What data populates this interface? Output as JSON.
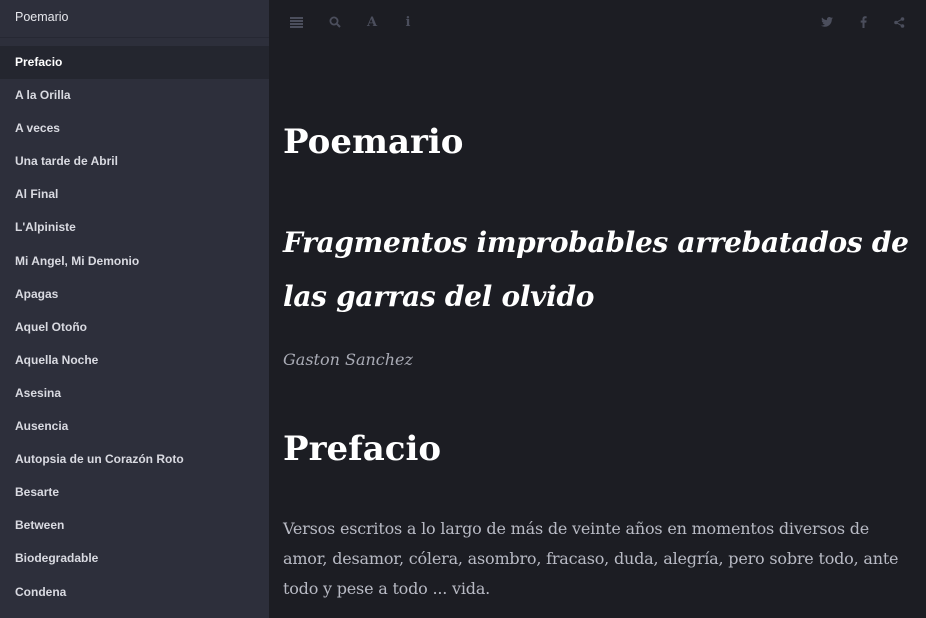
{
  "sidebar": {
    "title": "Poemario",
    "items": [
      {
        "label": "Prefacio",
        "active": true
      },
      {
        "label": "A la Orilla"
      },
      {
        "label": "A veces"
      },
      {
        "label": "Una tarde de Abril"
      },
      {
        "label": "Al Final"
      },
      {
        "label": "L'Alpiniste"
      },
      {
        "label": "Mi Angel, Mi Demonio"
      },
      {
        "label": "Apagas"
      },
      {
        "label": "Aquel Otoño"
      },
      {
        "label": "Aquella Noche"
      },
      {
        "label": "Asesina"
      },
      {
        "label": "Ausencia"
      },
      {
        "label": "Autopsia de un Corazón Roto"
      },
      {
        "label": "Besarte"
      },
      {
        "label": "Between"
      },
      {
        "label": "Biodegradable"
      },
      {
        "label": "Condena"
      }
    ]
  },
  "toolbar": {
    "left_icons": [
      "menu-icon",
      "search-icon",
      "font-settings-icon",
      "info-icon"
    ],
    "font_glyph": "A",
    "info_glyph": "i",
    "right_icons": [
      "twitter-icon",
      "facebook-icon",
      "share-icon"
    ]
  },
  "content": {
    "book_title": "Poemario",
    "subtitle": "Fragmentos improbables arrebatados de las garras del olvido",
    "author": "Gaston Sanchez",
    "chapter_title": "Prefacio",
    "chapter_text": "Versos escritos a lo largo de más de veinte años en momentos diversos de amor, desamor, cólera, asombro, fracaso, duda, alegría, pero sobre todo, ante todo y pese a todo ... vida."
  },
  "colors": {
    "sidebar_bg": "#2d2f3b",
    "content_bg": "#1c1d23",
    "active_item_bg": "#24262f",
    "icon_color": "#4b4e5c"
  }
}
